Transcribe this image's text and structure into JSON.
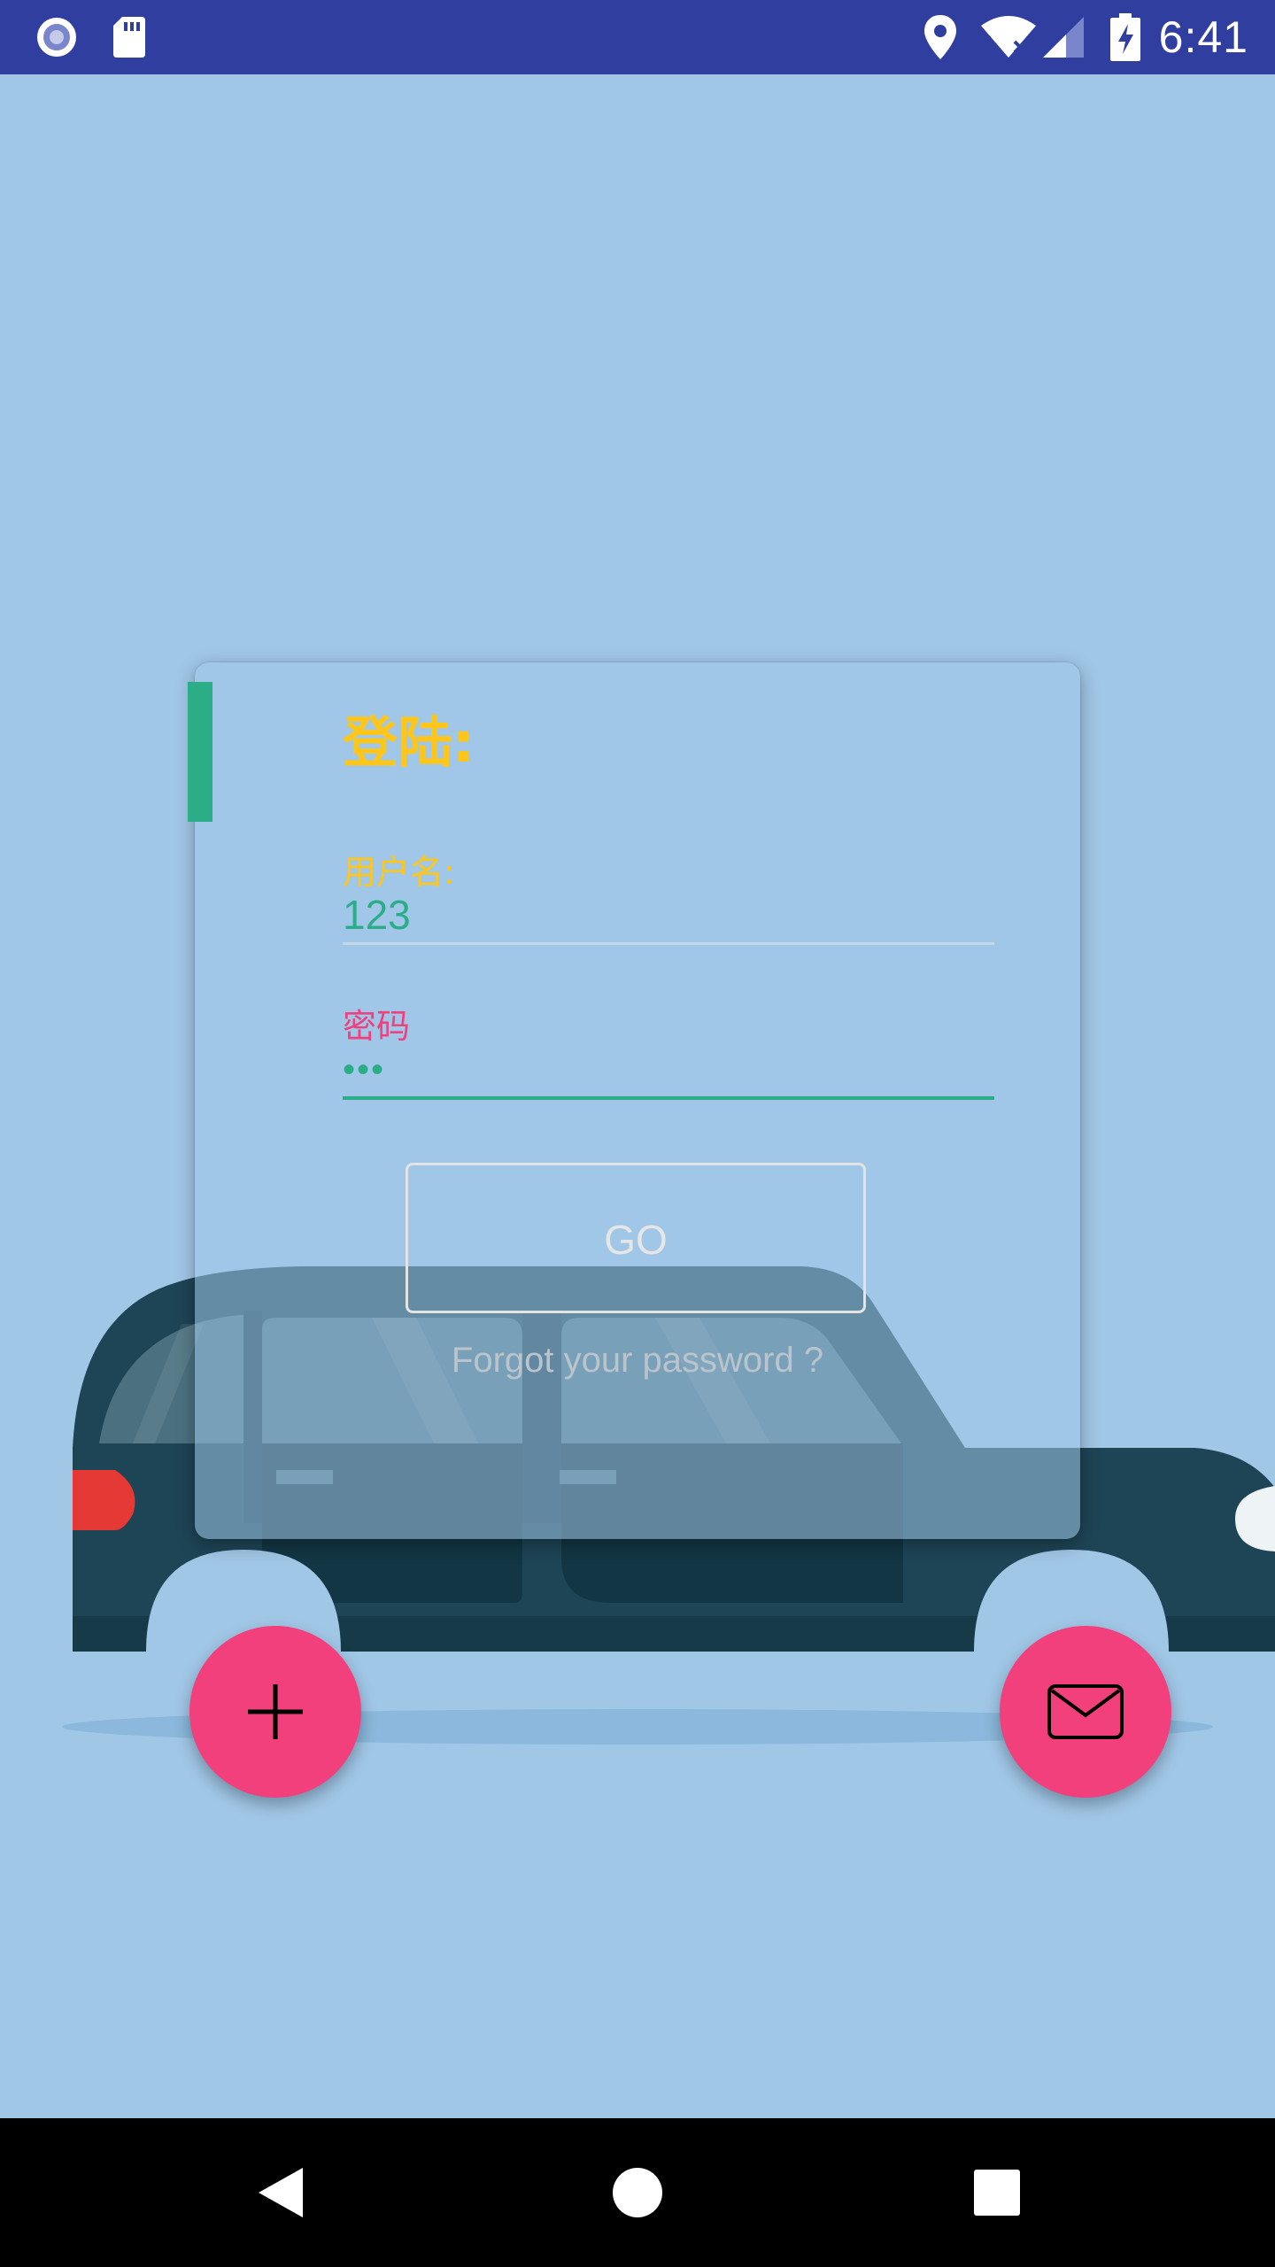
{
  "status_bar": {
    "time": "6:41",
    "left_icons": [
      "radio-icon",
      "sd-card-icon"
    ],
    "right_icons": [
      "location-icon",
      "wifi-off-icon",
      "cell-signal-icon",
      "battery-charging-icon"
    ],
    "background_color": "#303f9f"
  },
  "login_card": {
    "title": "登陆:",
    "username_label": "用户名:",
    "username_value": "123",
    "password_label": "密码",
    "password_value": "•••",
    "go_button_label": "GO",
    "forgot_password_link": "Forgot your password ?"
  },
  "fabs": {
    "add_icon": "plus-icon",
    "mail_icon": "mail-icon",
    "color": "#f2407d"
  },
  "nav_bar": {
    "buttons": [
      "back-icon",
      "home-icon",
      "recents-icon"
    ]
  },
  "colors": {
    "background": "#a1c7e7",
    "accent_green": "#2bae88",
    "title_yellow": "#ffc61a",
    "label_pink": "#f0407e"
  }
}
